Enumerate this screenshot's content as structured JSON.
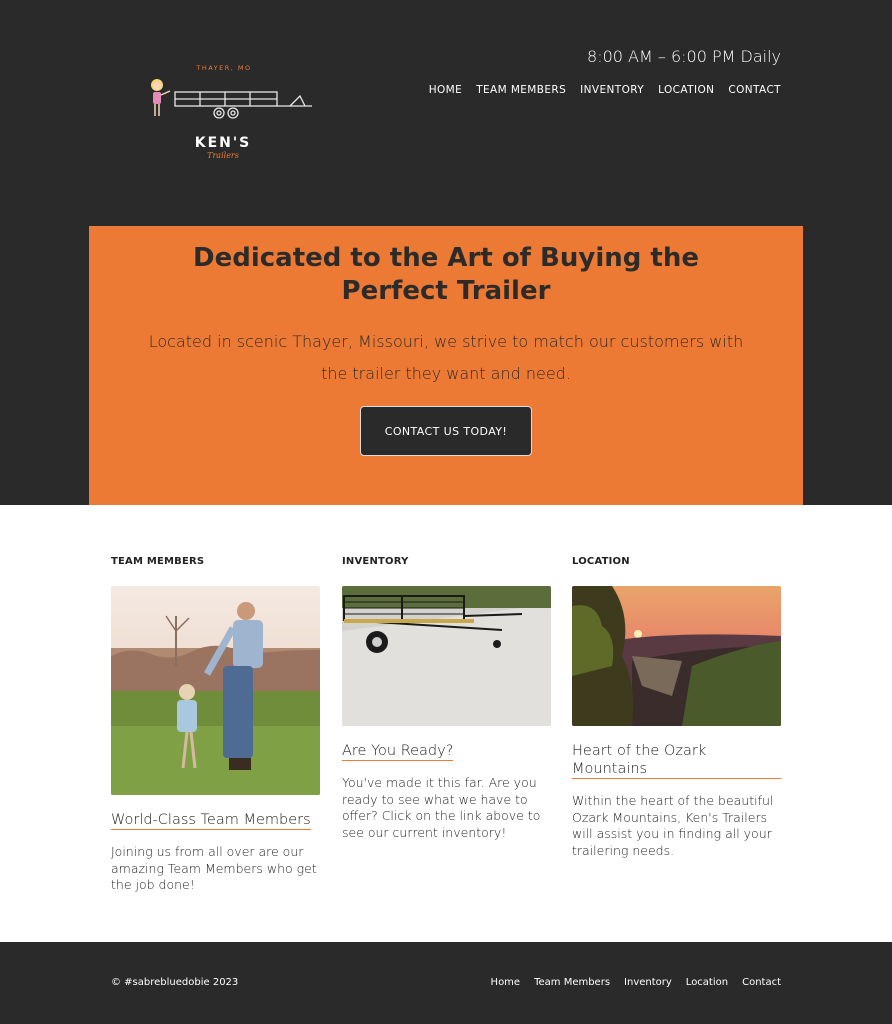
{
  "header": {
    "hours": "8:00 AM – 6:00 PM Daily",
    "logo": {
      "top_text": "THAYER, MO",
      "name": "KEN'S",
      "script": "Trailers"
    },
    "nav": [
      "HOME",
      "TEAM MEMBERS",
      "INVENTORY",
      "LOCATION",
      "CONTACT"
    ]
  },
  "hero": {
    "title": "Dedicated to the Art of Buying the Perfect Trailer",
    "text": "Located in scenic Thayer, Missouri, we strive to match our customers with the trailer they want and need.",
    "cta": "CONTACT US TODAY!"
  },
  "columns": [
    {
      "heading": "TEAM MEMBERS",
      "title": "World-Class Team Members",
      "text": "Joining us from all over are our amazing Team Members who get the job done!",
      "image_icon": "father-daughter-photo"
    },
    {
      "heading": "INVENTORY",
      "title": "Are You Ready?",
      "text": "You've made it this far. Are you ready to see what we have to offer? Click on the link above to see our current inventory!",
      "image_icon": "trailer-lot-photo"
    },
    {
      "heading": "LOCATION",
      "title": "Heart of the Ozark Mountains",
      "text": "Within the heart of the beautiful Ozark Mountains, Ken's Trailers will assist you in finding all your trailering needs.",
      "image_icon": "ozark-sunset-photo"
    }
  ],
  "footer": {
    "copyright": "© #sabrebluedobie 2023",
    "nav": [
      "Home",
      "Team Members",
      "Inventory",
      "Location",
      "Contact"
    ]
  },
  "colors": {
    "accent": "#ec7a35",
    "dark": "#2a2a2a"
  }
}
